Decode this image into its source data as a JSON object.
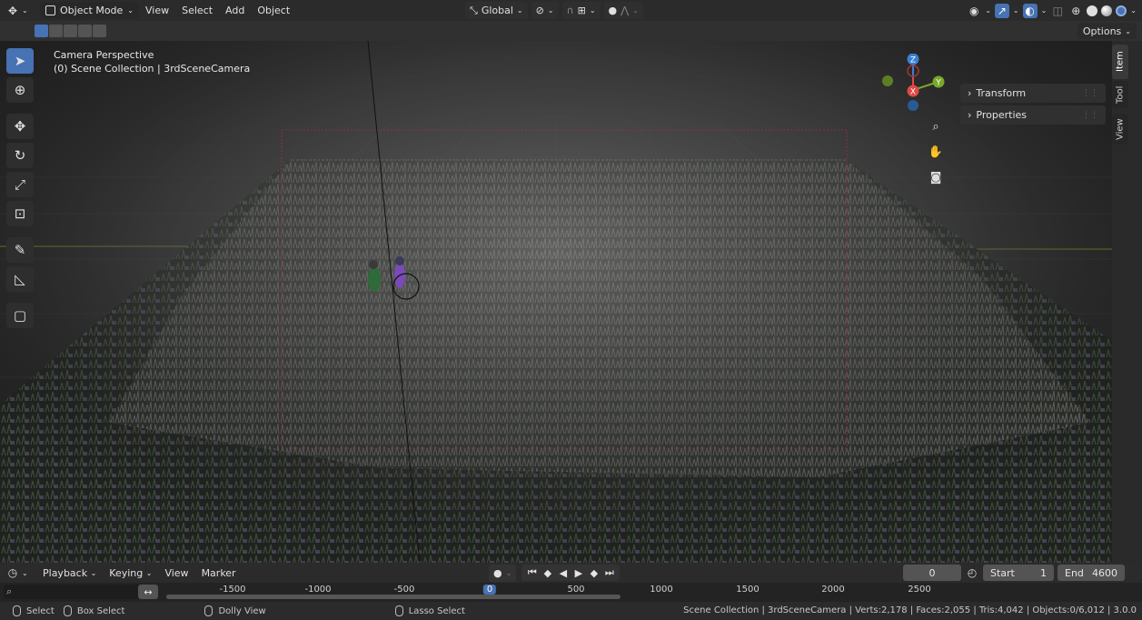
{
  "header": {
    "mode": "Object Mode",
    "menus": [
      "View",
      "Select",
      "Add",
      "Object"
    ],
    "transform_orientation": "Global"
  },
  "subbar": {
    "options_label": "Options"
  },
  "viewport": {
    "overlay_line1": "Camera Perspective",
    "overlay_line2": "(0) Scene Collection | 3rdSceneCamera",
    "gizmo_axes": {
      "x": "X",
      "y": "Y",
      "z": "Z"
    }
  },
  "npanel": {
    "panels": [
      "Transform",
      "Properties"
    ],
    "tabs": [
      "Item",
      "Tool",
      "View"
    ]
  },
  "timeline": {
    "menus": [
      "Playback",
      "Keying",
      "View",
      "Marker"
    ],
    "current_frame": "0",
    "start_label": "Start",
    "start_value": "1",
    "end_label": "End",
    "end_value": "4600",
    "ruler_ticks": [
      "-1500",
      "-1000",
      "-500",
      "0",
      "500",
      "1000",
      "1500",
      "2000",
      "2500"
    ]
  },
  "statusbar": {
    "select": "Select",
    "box_select": "Box Select",
    "dolly_view": "Dolly View",
    "lasso_select": "Lasso Select",
    "stats": "Scene Collection | 3rdSceneCamera | Verts:2,178 | Faces:2,055 | Tris:4,042 | Objects:0/6,012 | 3.0.0"
  },
  "colors": {
    "accent": "#4772b3",
    "axis_x": "#e04848",
    "axis_y": "#7aa82a",
    "axis_z": "#3a7fd0"
  }
}
